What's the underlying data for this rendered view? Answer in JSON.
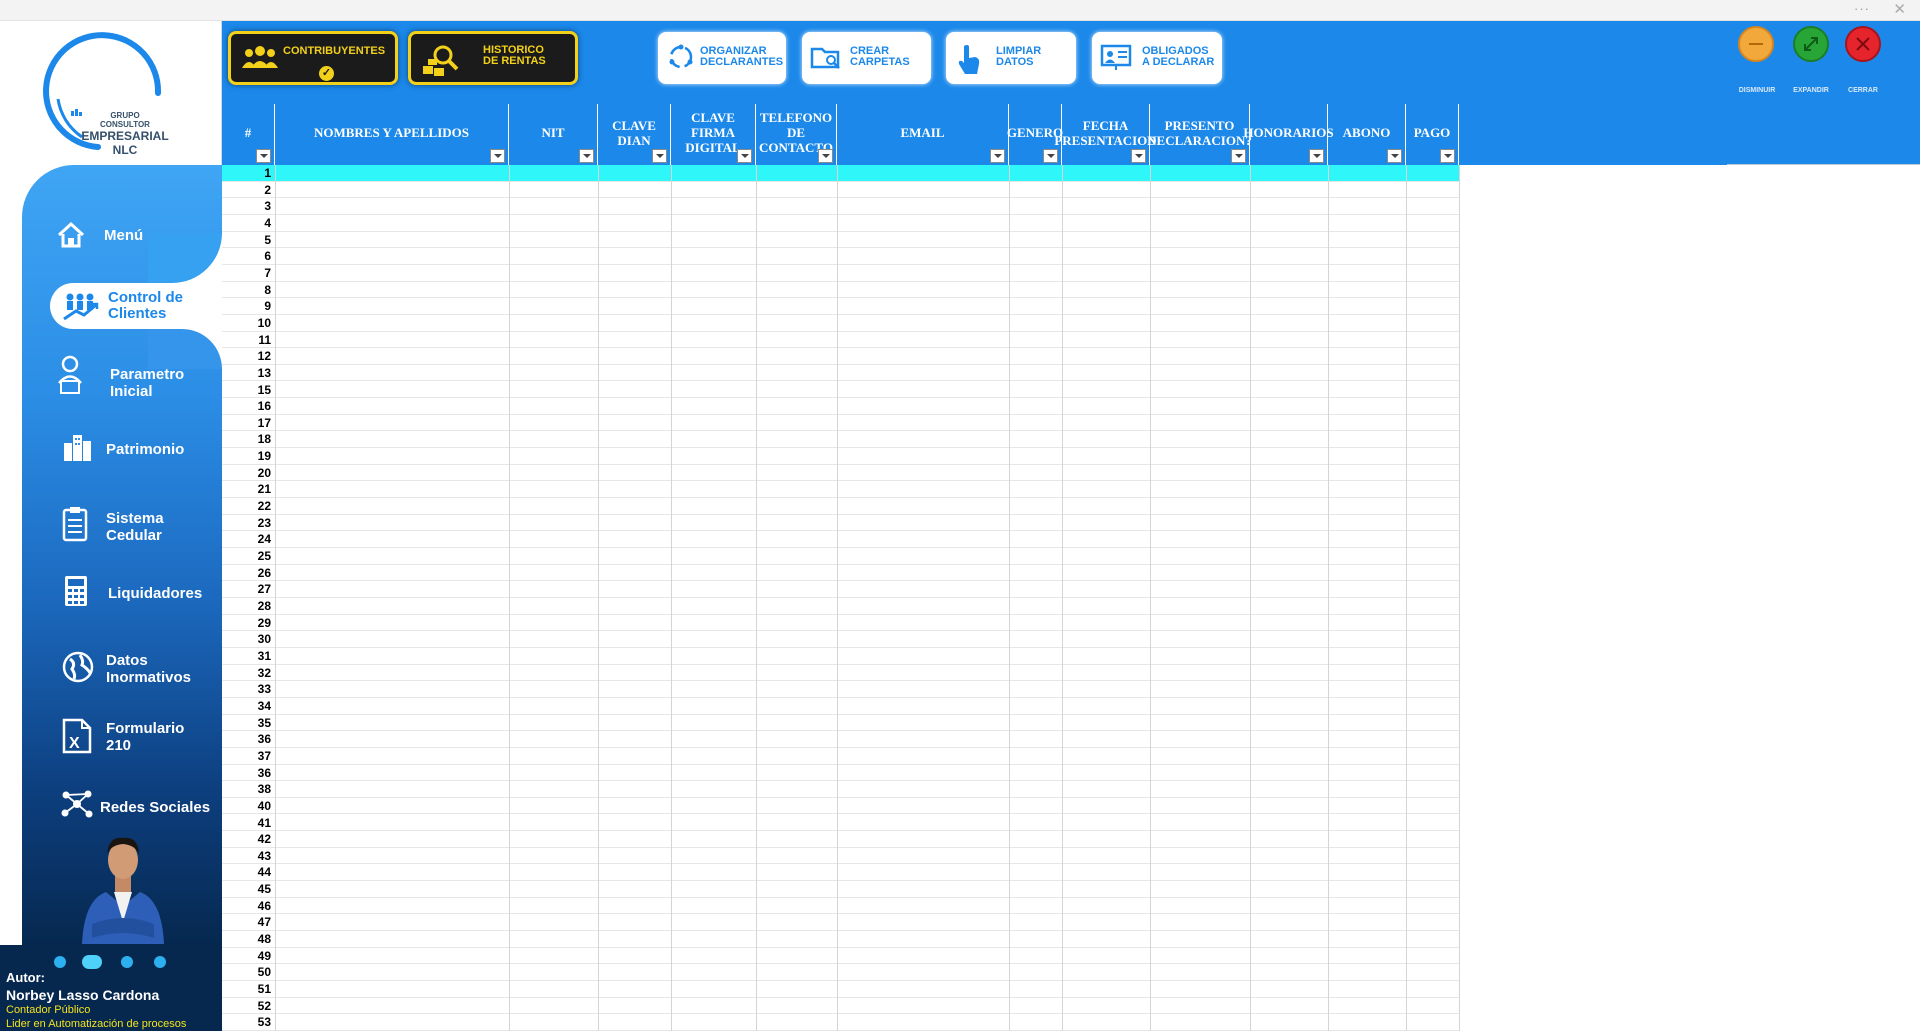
{
  "window": {
    "menu_dots": "···",
    "close_glyph": "✕"
  },
  "logo": {
    "line1": "GRUPO",
    "line2": "CONSULTOR",
    "line3": "EMPRESARIAL NLC"
  },
  "toolbar": {
    "contribuyentes": "CONTRIBUYENTES",
    "historico_line1": "HISTORICO",
    "historico_line2": "DE RENTAS",
    "organizar_line1": "ORGANIZAR",
    "organizar_line2": "DECLARANTES",
    "crear_line1": "CREAR",
    "crear_line2": "CARPETAS",
    "limpiar_line1": "LIMPIAR",
    "limpiar_line2": "DATOS",
    "obligados_line1": "OBLIGADOS",
    "obligados_line2": "A DECLARAR"
  },
  "window_controls": {
    "minimize": "DISMINUIR",
    "expand": "EXPANDIR",
    "close": "CERRAR",
    "minimize_color": "#f2a83a",
    "expand_color": "#27a637",
    "close_color": "#e5242c"
  },
  "sidebar": {
    "menu": "Menú",
    "control_line1": "Control de",
    "control_line2": "Clientes",
    "parametro_line1": "Parametro",
    "parametro_line2": "Inicial",
    "patrimonio": "Patrimonio",
    "sistema_line1": "Sistema",
    "sistema_line2": "Cedular",
    "liquidadores": "Liquidadores",
    "datos_line1": "Datos",
    "datos_line2": "Inormativos",
    "formulario_line1": "Formulario",
    "formulario_line2": "210",
    "redes": "Redes Sociales"
  },
  "author": {
    "label": "Autor:",
    "name": "Norbey Lasso Cardona",
    "title": "Contador Público",
    "subtitle": "Lider en Automatización de procesos"
  },
  "table": {
    "columns": [
      {
        "key": "num",
        "l1": "#",
        "l2": ""
      },
      {
        "key": "nombres",
        "l1": "NOMBRES Y APELLIDOS",
        "l2": ""
      },
      {
        "key": "nit",
        "l1": "NIT",
        "l2": ""
      },
      {
        "key": "clave_dian",
        "l1": "CLAVE DIAN",
        "l2": ""
      },
      {
        "key": "clave_firma",
        "l1": "CLAVE FIRMA",
        "l2": "DIGITAL"
      },
      {
        "key": "telefono",
        "l1": "TELEFONO DE",
        "l2": "CONTACTO"
      },
      {
        "key": "email",
        "l1": "EMAIL",
        "l2": ""
      },
      {
        "key": "genero",
        "l1": "GENERO",
        "l2": ""
      },
      {
        "key": "fecha",
        "l1": "FECHA",
        "l2": "PRESENTACION"
      },
      {
        "key": "presento",
        "l1": "PRESENTO",
        "l2": "DECLARACION?"
      },
      {
        "key": "honorarios",
        "l1": "HONORARIOS",
        "l2": ""
      },
      {
        "key": "abono",
        "l1": "ABONO",
        "l2": ""
      },
      {
        "key": "pago",
        "l1": "PAGO",
        "l2": ""
      }
    ],
    "row_numbers": [
      "1",
      "2",
      "3",
      "4",
      "5",
      "6",
      "7",
      "8",
      "9",
      "10",
      "11",
      "12",
      "13",
      "15",
      "16",
      "17",
      "18",
      "19",
      "20",
      "21",
      "22",
      "23",
      "24",
      "25",
      "26",
      "27",
      "28",
      "29",
      "30",
      "31",
      "32",
      "33",
      "34",
      "35",
      "36",
      "37",
      "36",
      "38",
      "40",
      "41",
      "42",
      "43",
      "44",
      "45",
      "46",
      "47",
      "48",
      "49",
      "50",
      "51",
      "52",
      "53"
    ],
    "highlight_color": "#2ff6f8"
  }
}
